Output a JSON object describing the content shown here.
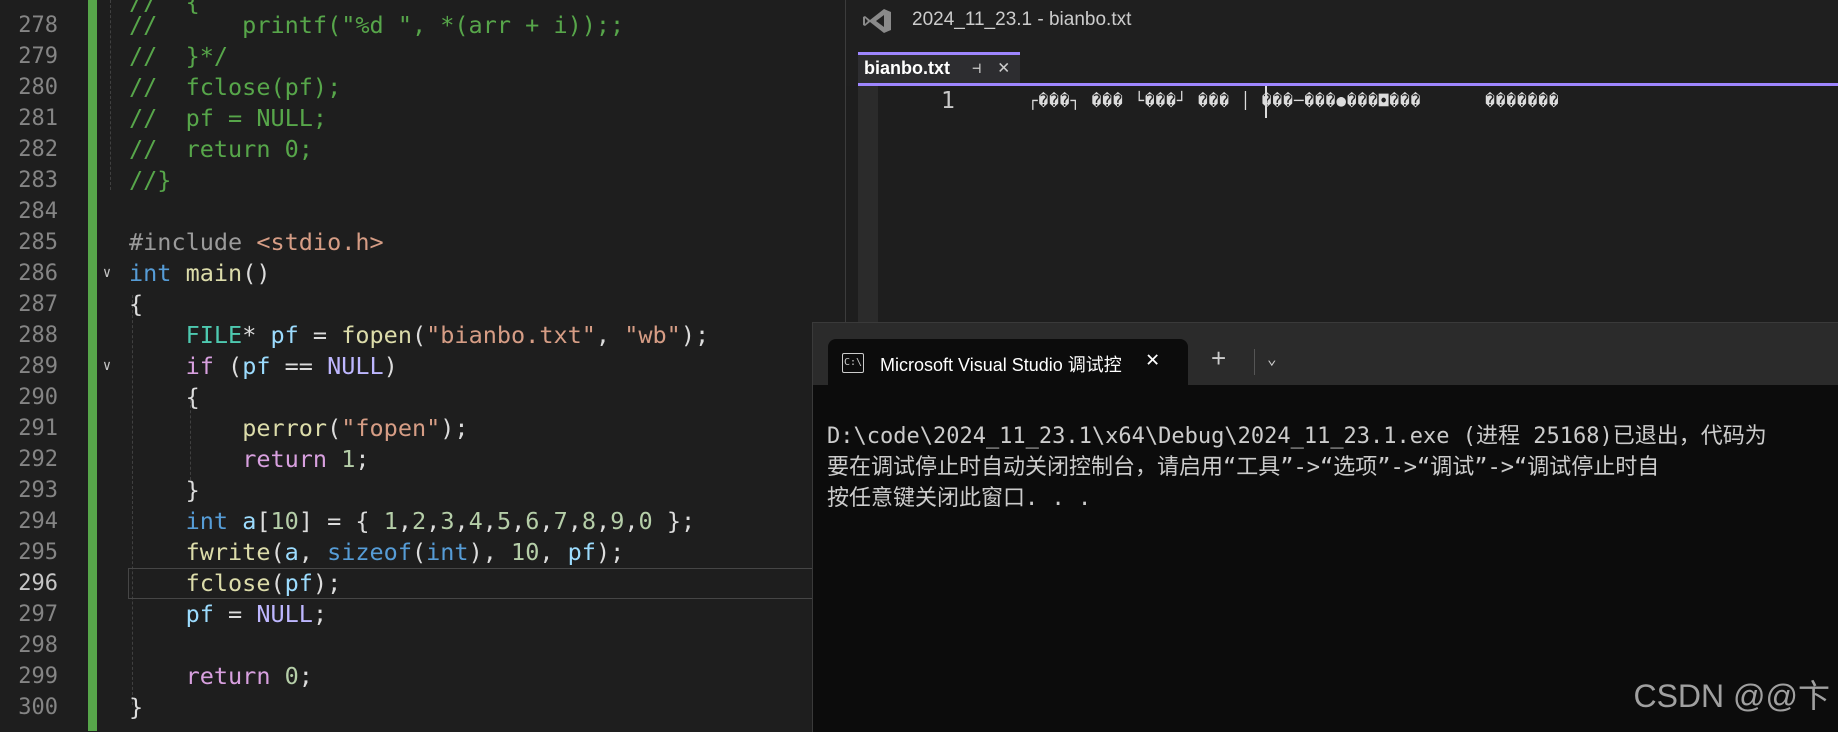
{
  "editor": {
    "line_numbers": [
      "278",
      "279",
      "280",
      "281",
      "282",
      "283",
      "284",
      "285",
      "286",
      "287",
      "288",
      "289",
      "290",
      "291",
      "292",
      "293",
      "294",
      "295",
      "296",
      "297",
      "298",
      "299",
      "300"
    ],
    "current_line": "296"
  },
  "text_window": {
    "title": "2024_11_23.1 - bianbo.txt",
    "tab_label": "bianbo.txt",
    "line_number": "1",
    "content": "┌���┐ ��� └���┘ ��� │ ���─���●���◘���      �������"
  },
  "console": {
    "tab_title": "Microsoft Visual Studio 调试控",
    "lines": [
      "D:\\code\\2024_11_23.1\\x64\\Debug\\2024_11_23.1.exe (进程 25168)已退出，代码为",
      "要在调试停止时自动关闭控制台，请启用“工具”->“选项”->“调试”->“调试停止时自",
      "按任意键关闭此窗口. . ."
    ]
  },
  "watermark": "CSDN @@卞"
}
